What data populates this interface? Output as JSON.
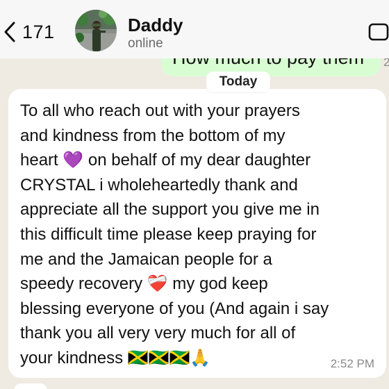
{
  "header": {
    "back_count": "171",
    "contact_name": "Daddy",
    "contact_status": "online"
  },
  "previous_message": {
    "text": "How much to pay them",
    "time": "2"
  },
  "date_divider": "Today",
  "message": {
    "text": "To all who reach out with your prayers\nand kindness from the bottom of my\nheart 💜 on behalf of my dear daughter\nCRYSTAL i wholeheartedly thank and\nappreciate all the support you give me in\nthis difficult time please keep praying for\nme and the Jamaican people for a\nspeedy recovery ❤️‍🩹 my god keep\nblessing everyone of you (And again i say\nthank you all very very much for all of\nyour kindness 🇯🇲🇯🇲🇯🇲🙏",
    "time": "2:52 PM"
  },
  "icons": {
    "back": "chevron-left-icon",
    "video": "video-call-icon"
  },
  "colors": {
    "chat_background": "#efeae2",
    "header_background": "#f7f7f7",
    "outgoing_bubble": "#d9fdd3",
    "incoming_bubble": "#ffffff",
    "status_gray": "#6b6b6b"
  }
}
